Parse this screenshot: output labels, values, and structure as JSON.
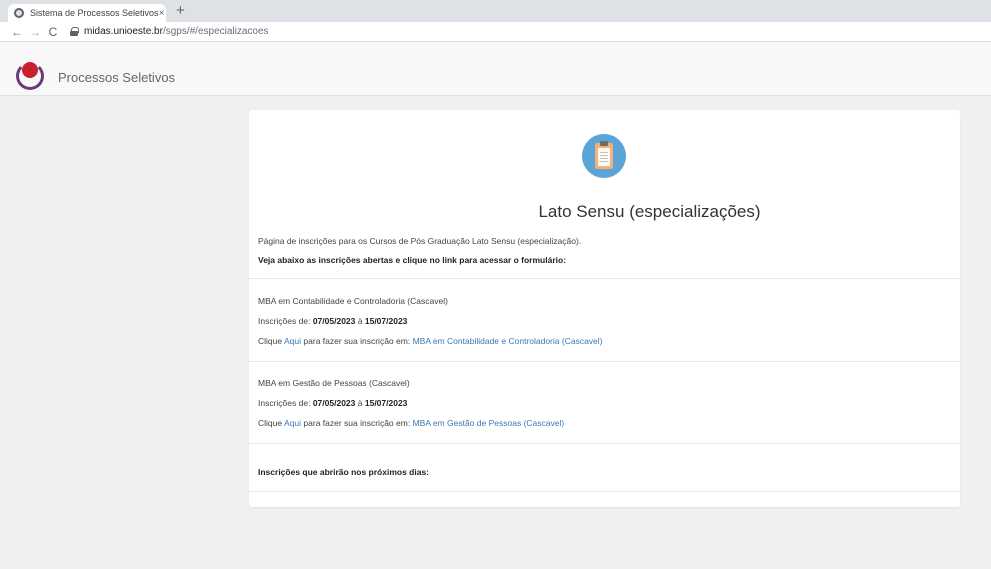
{
  "browser": {
    "tab_title": "Sistema de Processos Seletivos",
    "tab_close": "×",
    "new_tab": "+",
    "back": "←",
    "forward": "→",
    "reload": "C",
    "url_host": "midas.unioeste.br",
    "url_path": "/sgps/#/especializacoes"
  },
  "header": {
    "title": "Processos Seletivos"
  },
  "page": {
    "title": "Lato Sensu (especializações)",
    "intro": "Página de inscrições para os Cursos de Pós Graduação Lato Sensu (especialização).",
    "instruction": "Veja abaixo as inscrições abertas e clique no link para acessar o formulário:",
    "upcoming_heading": "Inscrições que abrirão nos próximos dias:"
  },
  "courses": [
    {
      "name": "MBA em Contabilidade e Controladoria (Cascavel)",
      "period_label": "Inscrições de:",
      "start": "07/05/2023",
      "sep": "à",
      "end": "15/07/2023",
      "click_prefix": "Clique",
      "here_link": "Aqui",
      "click_middle": "para fazer sua inscrição em:",
      "course_link": "MBA em Contabilidade e Controladoria (Cascavel)"
    },
    {
      "name": "MBA em Gestão de Pessoas (Cascavel)",
      "period_label": "Inscrições de:",
      "start": "07/05/2023",
      "sep": "à",
      "end": "15/07/2023",
      "click_prefix": "Clique",
      "here_link": "Aqui",
      "click_middle": "para fazer sua inscrição em:",
      "course_link": "MBA em Gestão de Pessoas (Cascavel)"
    }
  ]
}
